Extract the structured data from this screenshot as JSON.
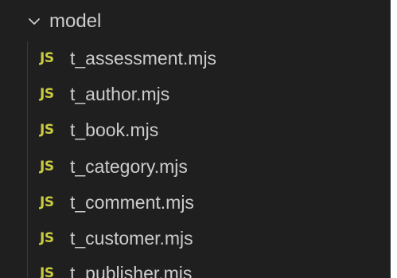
{
  "explorer": {
    "folder": {
      "name": "model",
      "expanded": true
    },
    "file_badge": "JS",
    "file_badge_color": "#cbcb41",
    "files": [
      "t_assessment.mjs",
      "t_author.mjs",
      "t_book.mjs",
      "t_category.mjs",
      "t_comment.mjs",
      "t_customer.mjs",
      "t_publisher.mjs"
    ]
  }
}
